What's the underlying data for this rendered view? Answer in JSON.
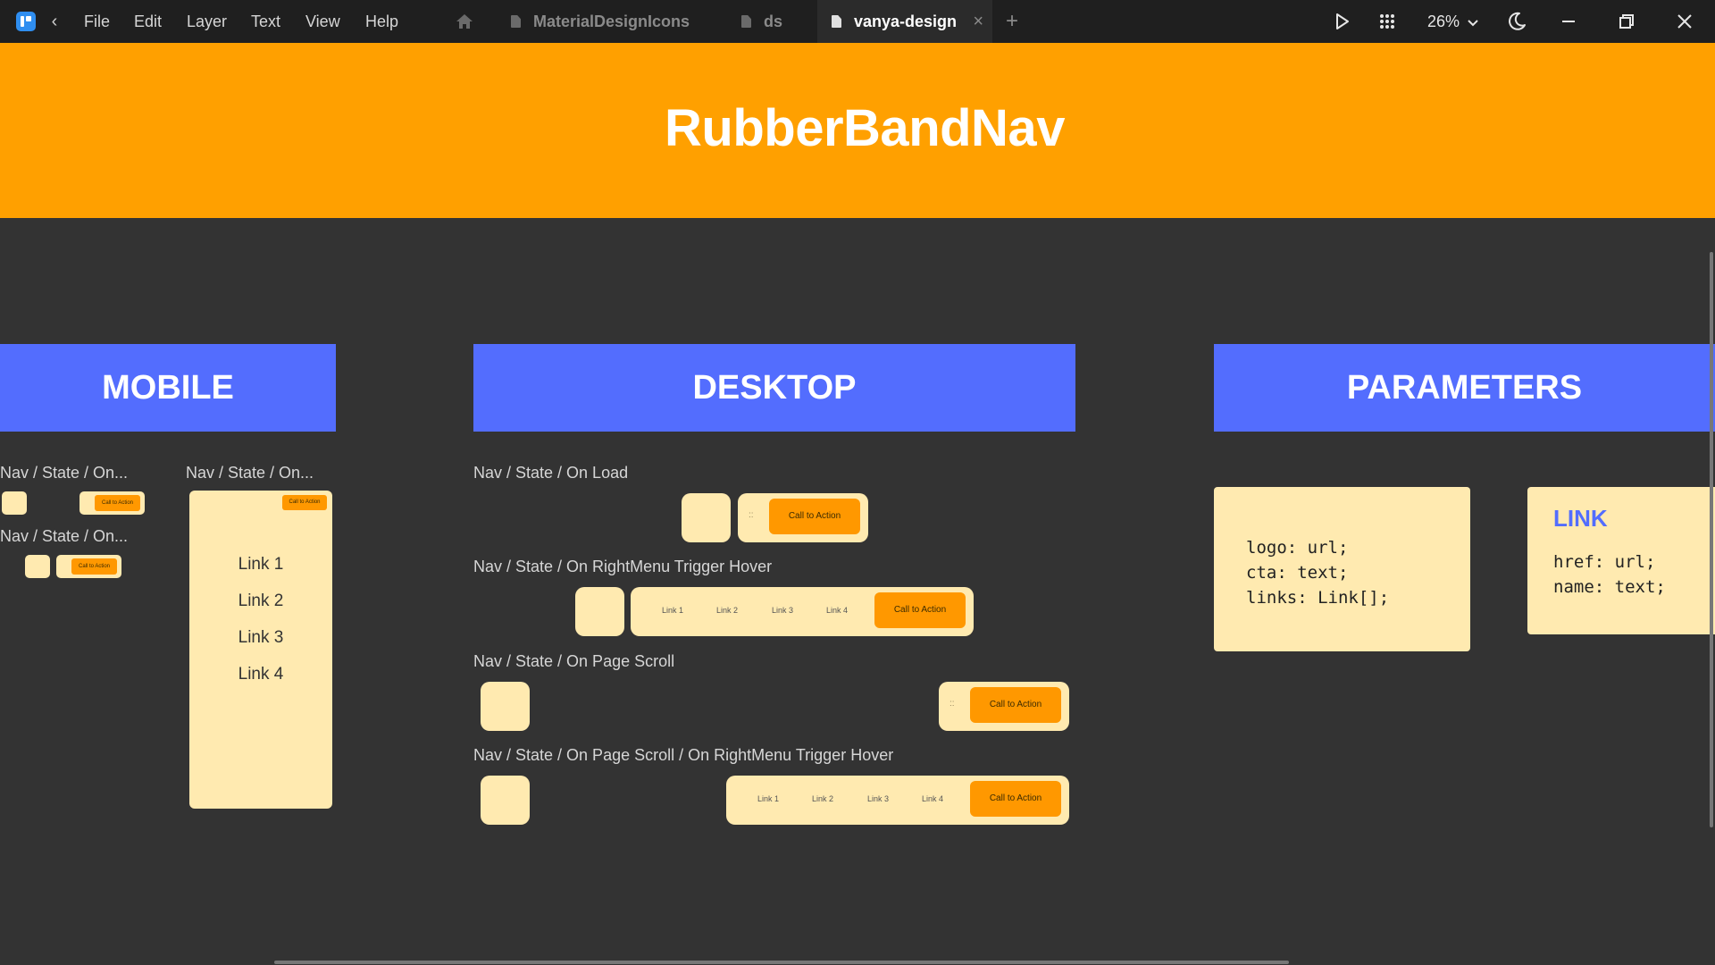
{
  "titlebar": {
    "menu": [
      "File",
      "Edit",
      "Layer",
      "Text",
      "View",
      "Help"
    ],
    "tabs": [
      {
        "label": "MaterialDesignIcons"
      },
      {
        "label": "ds"
      },
      {
        "label": "vanya-design",
        "close": "×"
      }
    ],
    "zoom": "26%"
  },
  "banner": {
    "title": "RubberBandNav"
  },
  "sections": {
    "mobile": "MOBILE",
    "desktop": "DESKTOP",
    "parameters": "PARAMETERS"
  },
  "mobile": {
    "label_a": "Nav / State / On...",
    "label_b": "Nav / State / On...",
    "label_c": "Nav / State / On...",
    "cta": "Call to Action",
    "links": [
      "Link 1",
      "Link 2",
      "Link 3",
      "Link 4"
    ]
  },
  "desktop": {
    "labels": [
      "Nav / State / On Load",
      "Nav / State / On RightMenu Trigger Hover",
      "Nav / State / On Page Scroll",
      "Nav / State / On Page Scroll / On RightMenu Trigger Hover"
    ],
    "cta": "Call to Action",
    "links": [
      "Link 1",
      "Link 2",
      "Link 3",
      "Link 4"
    ],
    "dots": "::"
  },
  "parameters": {
    "nav_code": "logo: url;\ncta: text;\nlinks: Link[];",
    "link_title": "LINK",
    "link_code": "href: url;\nname: text;"
  },
  "colors": {
    "banner": "#ffa000",
    "section_head": "#536dfe",
    "frame": "#ffeab0",
    "cta": "#ff9800",
    "canvas": "#333333"
  }
}
